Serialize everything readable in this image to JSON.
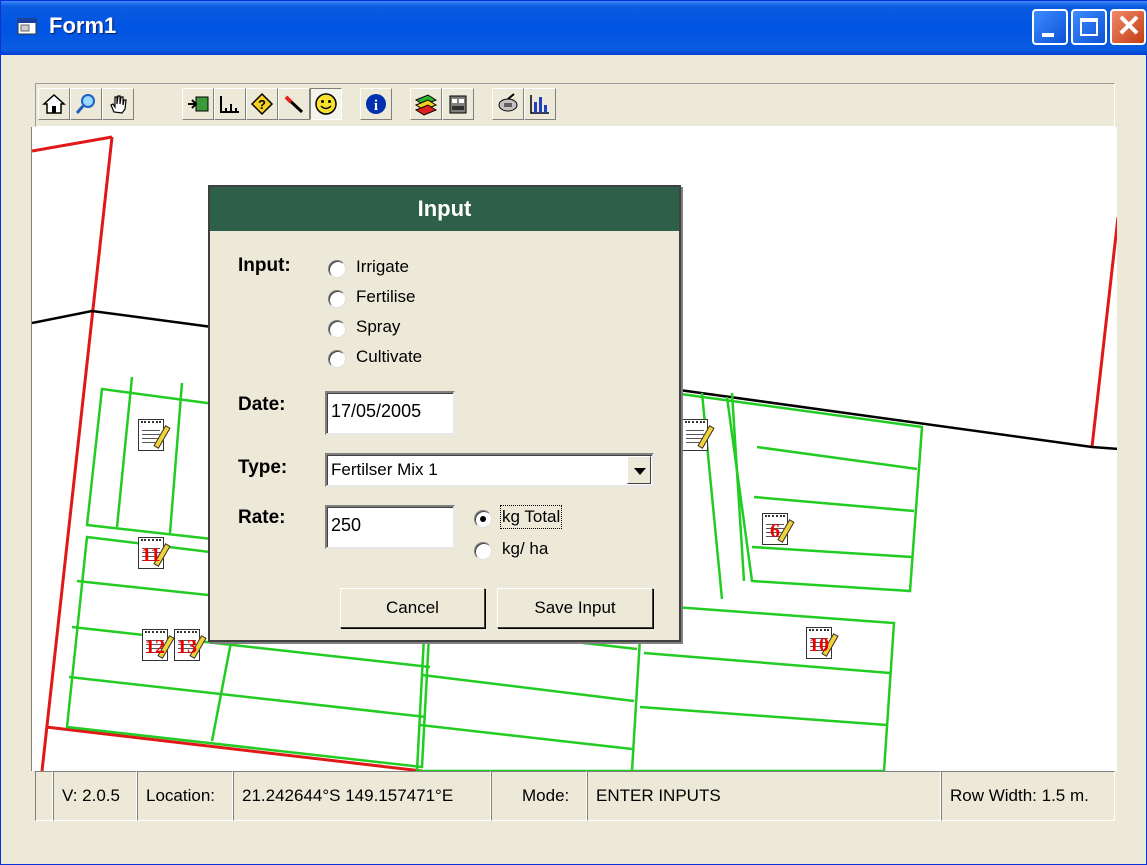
{
  "window": {
    "title": "Form1"
  },
  "toolbar": {
    "tools": [
      {
        "name": "home-icon"
      },
      {
        "name": "zoom-icon"
      },
      {
        "name": "pan-hand-icon"
      },
      {
        "name": "import-icon"
      },
      {
        "name": "measure-icon"
      },
      {
        "name": "query-icon"
      },
      {
        "name": "magic-wand-icon"
      },
      {
        "name": "smiley-icon"
      },
      {
        "name": "info-icon"
      },
      {
        "name": "layers-icon"
      },
      {
        "name": "database-icon"
      },
      {
        "name": "satellite-icon"
      },
      {
        "name": "chart-icon"
      }
    ]
  },
  "map": {
    "markers": [
      "11",
      "12",
      "13",
      "6",
      "10"
    ]
  },
  "dialog": {
    "title": "Input",
    "input_label": "Input:",
    "input_options": [
      "Irrigate",
      "Fertilise",
      "Spray",
      "Cultivate"
    ],
    "date_label": "Date:",
    "date_value": "17/05/2005",
    "type_label": "Type:",
    "type_value": "Fertilser Mix 1",
    "rate_label": "Rate:",
    "rate_value": "250",
    "rate_units": [
      "kg Total",
      "kg/ ha"
    ],
    "rate_units_selected": "kg Total",
    "cancel_label": "Cancel",
    "save_label": "Save Input"
  },
  "status": {
    "version": "V: 2.0.5",
    "location_label": "Location:",
    "location_value": "21.242644°S  149.157471°E",
    "mode_label": "Mode:",
    "mode_value": "ENTER INPUTS",
    "row_width": "Row Width: 1.5 m."
  },
  "colors": {
    "dialog_title_bg": "#2E5F48",
    "field_outline": "#22CC22",
    "boundary": "#E01818",
    "road": "#000000"
  }
}
